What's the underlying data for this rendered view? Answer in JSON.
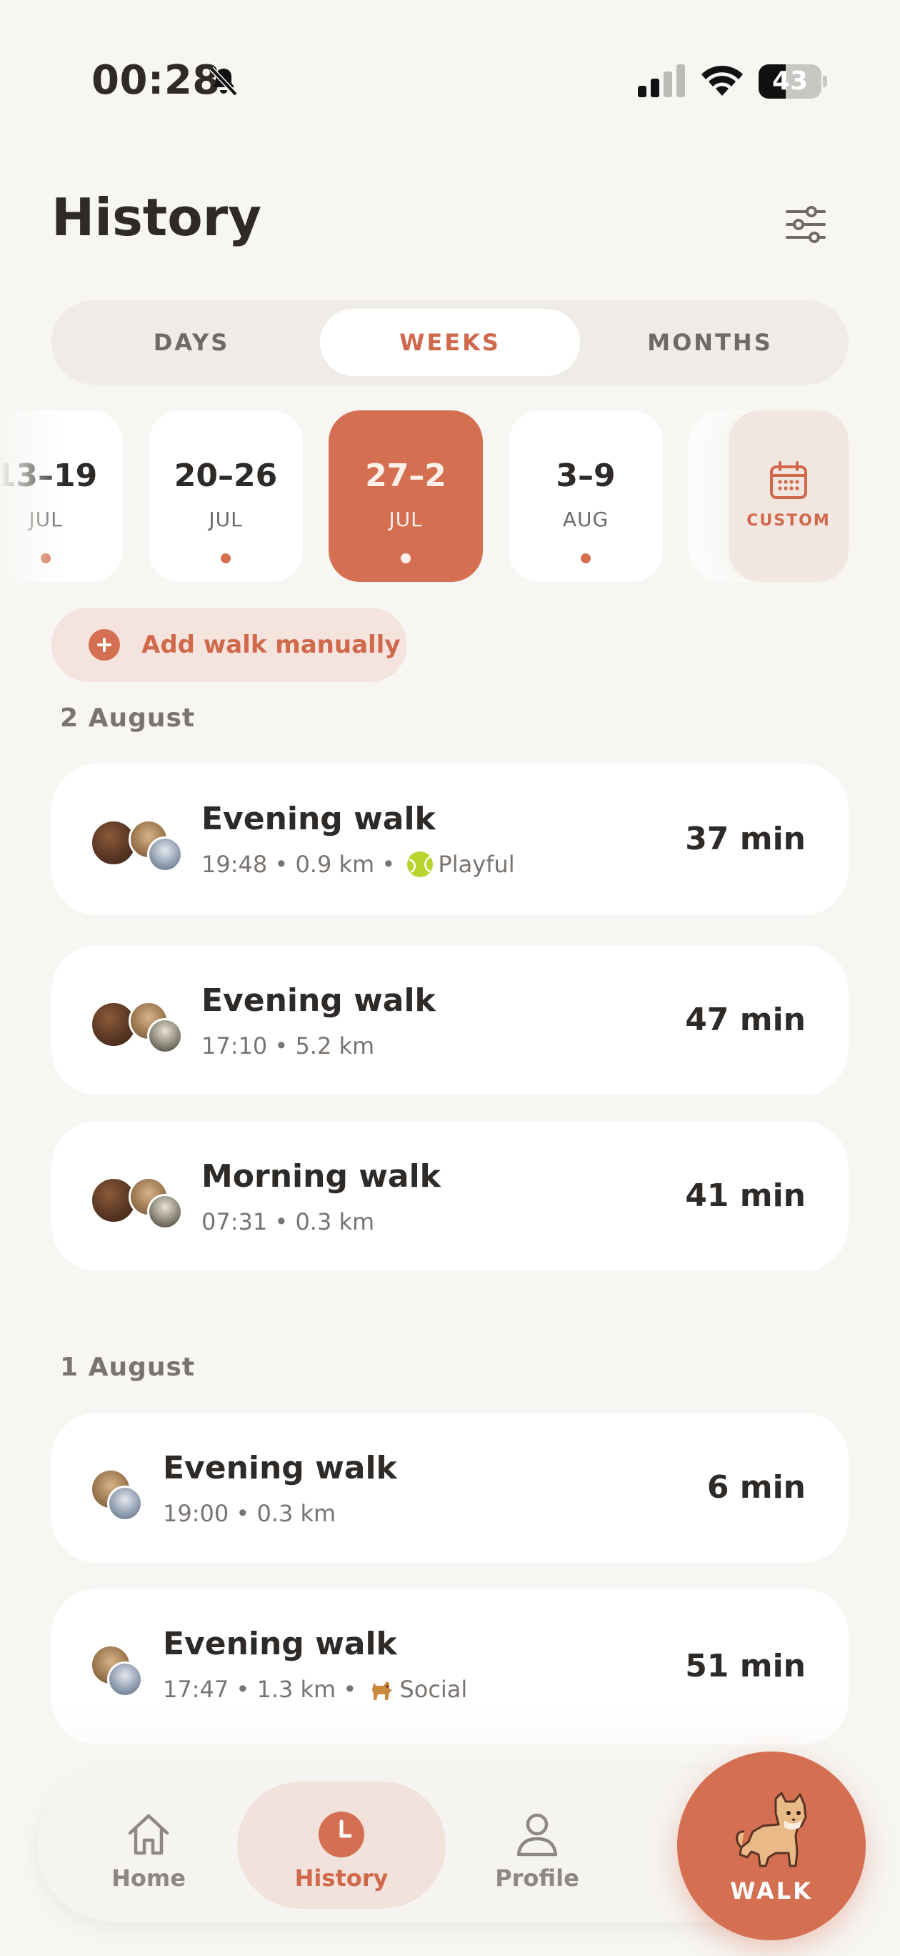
{
  "status_bar": {
    "time": "00:28",
    "battery": "43",
    "battery_level": 0.43
  },
  "header": {
    "title": "History"
  },
  "segments": [
    {
      "label": "DAYS",
      "active": false
    },
    {
      "label": "WEEKS",
      "active": true
    },
    {
      "label": "MONTHS",
      "active": false
    }
  ],
  "weeks": [
    {
      "range": "13–19",
      "month": "JUL",
      "has_walks": true
    },
    {
      "range": "20–26",
      "month": "JUL",
      "has_walks": true
    },
    {
      "range": "27–2",
      "month": "JUL",
      "has_walks": true,
      "active": true
    },
    {
      "range": "3–9",
      "month": "AUG",
      "has_walks": true
    }
  ],
  "custom": {
    "label": "CUSTOM"
  },
  "add_walk": {
    "label": "Add walk manually"
  },
  "sections": [
    {
      "label": "2 August",
      "walks": [
        {
          "title": "Evening walk",
          "time": "19:48",
          "distance": "0.9 km",
          "mood": "Playful",
          "duration": "37 min"
        },
        {
          "title": "Evening walk",
          "time": "17:10",
          "distance": "5.2 km",
          "duration": "47 min"
        },
        {
          "title": "Morning walk",
          "time": "07:31",
          "distance": "0.3 km",
          "duration": "41 min"
        }
      ]
    },
    {
      "label": "1 August",
      "walks": [
        {
          "title": "Evening walk",
          "time": "19:00",
          "distance": "0.3 km",
          "duration": "6 min"
        },
        {
          "title": "Evening walk",
          "time": "17:47",
          "distance": "1.3 km",
          "mood": "Social",
          "duration": "51 min"
        }
      ]
    }
  ],
  "meta_separator": "•",
  "nav": {
    "home": "Home",
    "history": "History",
    "profile": "Profile",
    "walk": "WALK"
  },
  "colors": {
    "accent": "#d46f52",
    "background": "#f7f6f3",
    "card": "#ffffff"
  }
}
